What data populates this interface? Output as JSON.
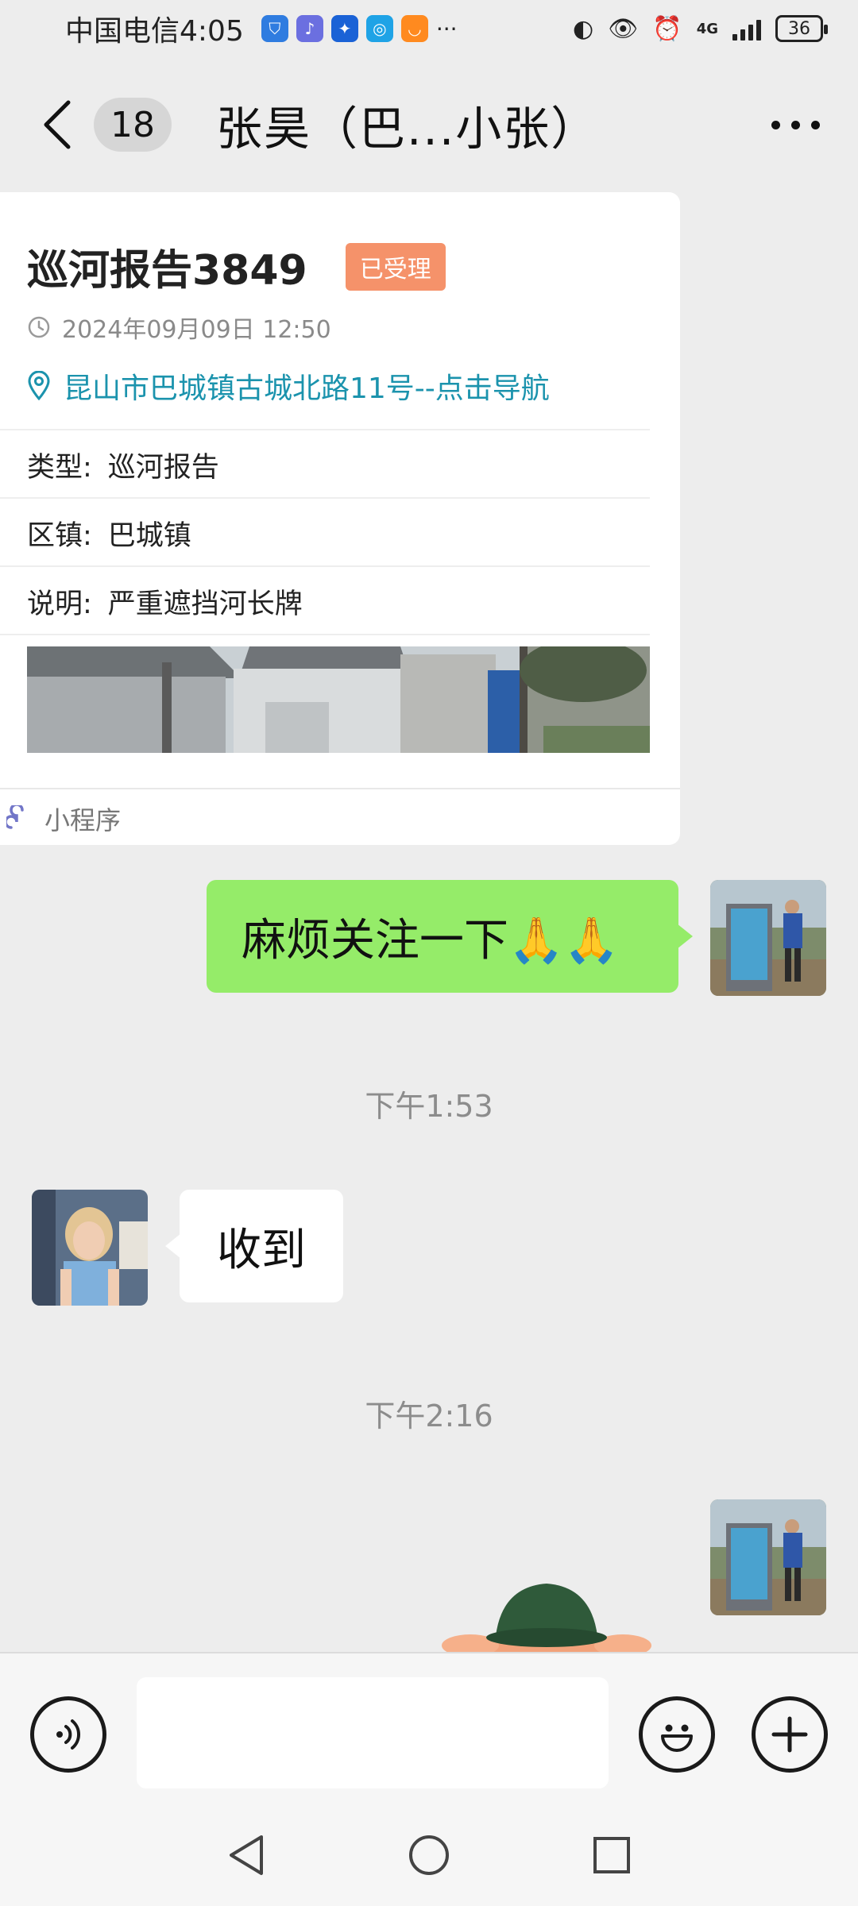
{
  "status_bar": {
    "carrier_time": "中国电信4:05",
    "network": "4G",
    "battery": "36"
  },
  "header": {
    "unread_count": "18",
    "title": "张昊（巴...小张）"
  },
  "card": {
    "title": "巡河报告3849",
    "status": "已受理",
    "datetime": "2024年09月09日 12:50",
    "address": "昆山市巴城镇古城北路11号--点击导航",
    "rows": [
      {
        "label": "类型:",
        "value": "巡河报告"
      },
      {
        "label": "区镇:",
        "value": "巴城镇"
      },
      {
        "label": "说明:",
        "value": "严重遮挡河长牌"
      }
    ],
    "footer_label": "小程序"
  },
  "messages": {
    "sent_1": "麻烦关注一下🙏🙏",
    "time_1": "下午1:53",
    "received_1": "收到",
    "time_2": "下午2:16"
  },
  "colors": {
    "sent_bubble": "#95ec69",
    "status_badge": "#f5926a",
    "address_link": "#1b93ad"
  }
}
